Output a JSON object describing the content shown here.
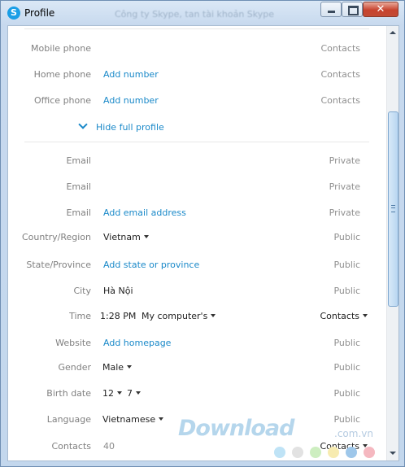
{
  "window": {
    "title": "Profile",
    "background_text": "Công ty Skype, tan tài khoản Skype"
  },
  "profile": {
    "rows": [
      {
        "label": "Mobile phone",
        "value": "",
        "privacy": "Contacts"
      },
      {
        "label": "Home phone",
        "value": "Add number",
        "privacy": "Contacts"
      },
      {
        "label": "Office phone",
        "value": "Add number",
        "privacy": "Contacts"
      }
    ],
    "hide_full_profile": "Hide full profile",
    "details": [
      {
        "label": "Email",
        "value": "",
        "privacy": "Private"
      },
      {
        "label": "Email",
        "value": "",
        "privacy": "Private"
      },
      {
        "label": "Email",
        "value": "Add email address",
        "privacy": "Private"
      },
      {
        "label": "Country/Region",
        "value": "Vietnam",
        "privacy": "Public"
      },
      {
        "label": "State/Province",
        "value": "Add state or province",
        "privacy": "Public"
      },
      {
        "label": "City",
        "value": "Hà Nội",
        "privacy": "Public"
      },
      {
        "label": "Time",
        "value": "1:28 PM",
        "value2": "My computer's",
        "privacy": "Contacts"
      },
      {
        "label": "Website",
        "value": "Add homepage",
        "privacy": "Public"
      },
      {
        "label": "Gender",
        "value": "Male",
        "privacy": "Public"
      },
      {
        "label": "Birth date",
        "value": "12",
        "value2": "7",
        "privacy": "Public"
      },
      {
        "label": "Language",
        "value": "Vietnamese",
        "privacy": "Public"
      },
      {
        "label": "Contacts",
        "value": "40",
        "privacy": "Contacts"
      }
    ]
  },
  "watermark": {
    "brand": "Download",
    "domain": ".com.vn",
    "dot_colors": [
      "#bfe3f6",
      "#e2e2e2",
      "#cdeec0",
      "#f7ebb0",
      "#9ec7ea",
      "#f5b8c0"
    ]
  },
  "icons": {
    "app": "skype-icon",
    "minimize": "minimize-icon",
    "maximize": "maximize-icon",
    "close": "close-icon"
  }
}
